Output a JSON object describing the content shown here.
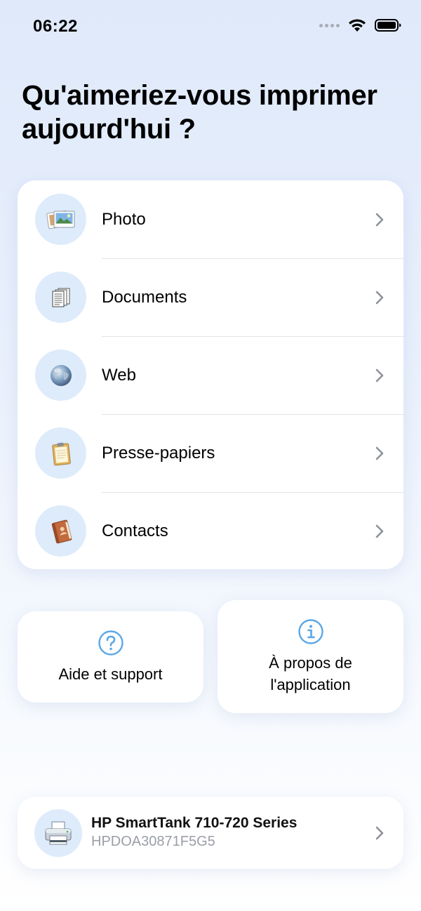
{
  "status_bar": {
    "time": "06:22",
    "icons": [
      "signal-dots-icon",
      "wifi-icon",
      "battery-icon"
    ]
  },
  "title": "Qu'aimeriez-vous imprimer aujourd'hui ?",
  "menu": {
    "items": [
      {
        "label": "Photo",
        "icon": "photo-icon"
      },
      {
        "label": "Documents",
        "icon": "documents-icon"
      },
      {
        "label": "Web",
        "icon": "globe-icon"
      },
      {
        "label": "Presse-papiers",
        "icon": "clipboard-icon"
      },
      {
        "label": "Contacts",
        "icon": "contacts-book-icon"
      }
    ]
  },
  "help_card": {
    "label": "Aide et support",
    "icon": "question-circle-icon"
  },
  "about_card": {
    "label_line1": "À propos de",
    "label_line2": "l'application",
    "icon": "info-circle-icon"
  },
  "printer": {
    "name": "HP SmartTank 710-720 Series",
    "id": "HPDOA30871F5G5",
    "icon": "printer-icon"
  },
  "colors": {
    "accent_blue": "#5aa7e6",
    "icon_circle_bg": "#ddebfb",
    "chevron_gray": "#8e929a",
    "secondary_text": "#9a9ea6"
  }
}
